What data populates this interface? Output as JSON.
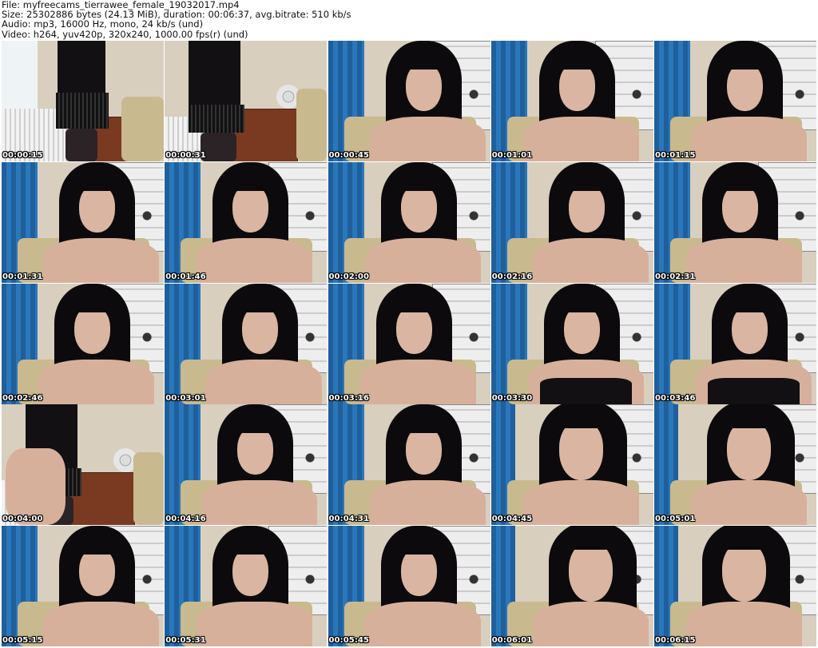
{
  "header": {
    "file": "File: myfreecams_tierrawee_female_19032017.mp4",
    "size": "Size: 25302886 bytes (24.13 MiB), duration: 00:06:37, avg.bitrate: 510 kb/s",
    "audio": "Audio: mp3, 16000 Hz, mono, 24 kb/s (und)",
    "video": "Video: h264, yuv420p, 320x240, 1000.00 fps(r) (und)"
  },
  "thumbnails": [
    {
      "time": "00:00:15",
      "scene": "standing-radiator"
    },
    {
      "time": "00:00:31",
      "scene": "standing-dresser"
    },
    {
      "time": "00:00:45",
      "scene": "seated"
    },
    {
      "time": "00:01:01",
      "scene": "seated"
    },
    {
      "time": "00:01:15",
      "scene": "seated"
    },
    {
      "time": "00:01:31",
      "scene": "seated"
    },
    {
      "time": "00:01:46",
      "scene": "seated-tilt"
    },
    {
      "time": "00:02:00",
      "scene": "seated"
    },
    {
      "time": "00:02:16",
      "scene": "seated"
    },
    {
      "time": "00:02:31",
      "scene": "seated"
    },
    {
      "time": "00:02:46",
      "scene": "seated"
    },
    {
      "time": "00:03:01",
      "scene": "seated"
    },
    {
      "time": "00:03:16",
      "scene": "seated"
    },
    {
      "time": "00:03:30",
      "scene": "seated-top"
    },
    {
      "time": "00:03:46",
      "scene": "seated-top"
    },
    {
      "time": "00:04:00",
      "scene": "standing-dresser"
    },
    {
      "time": "00:04:16",
      "scene": "seated"
    },
    {
      "time": "00:04:31",
      "scene": "seated"
    },
    {
      "time": "00:04:45",
      "scene": "seated-close"
    },
    {
      "time": "00:05:01",
      "scene": "seated-close"
    },
    {
      "time": "00:05:15",
      "scene": "seated"
    },
    {
      "time": "00:05:31",
      "scene": "seated"
    },
    {
      "time": "00:05:45",
      "scene": "seated"
    },
    {
      "time": "00:06:01",
      "scene": "seated-close"
    },
    {
      "time": "00:06:15",
      "scene": "seated-close"
    }
  ]
}
